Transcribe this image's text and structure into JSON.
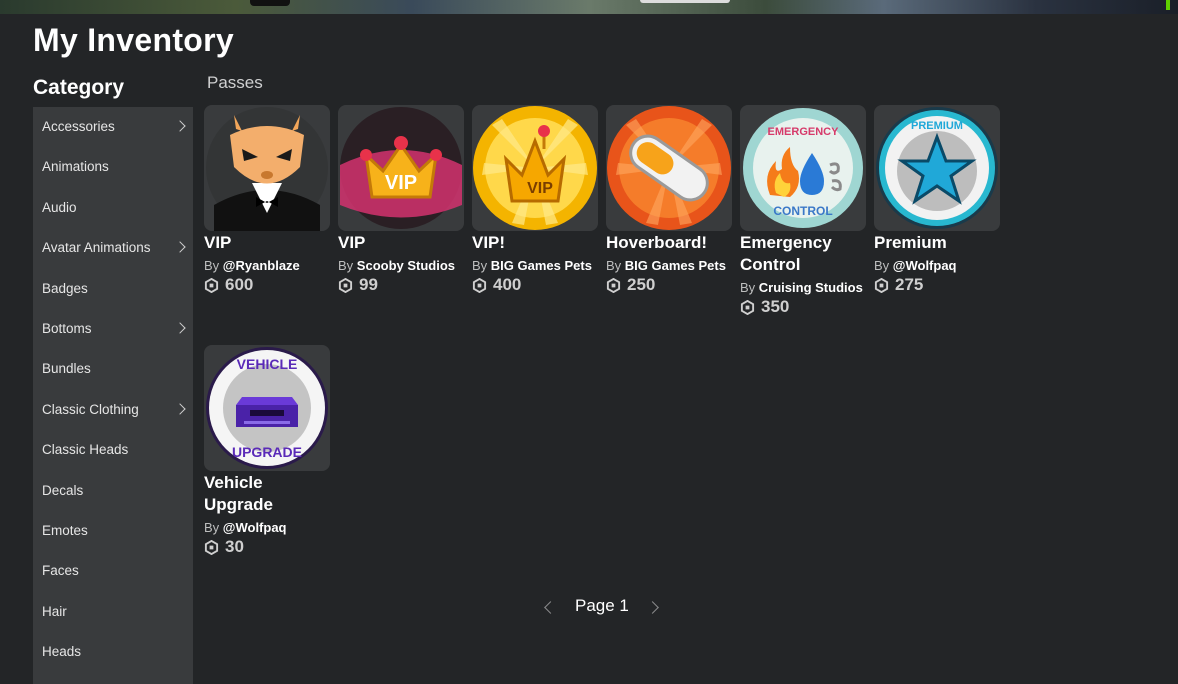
{
  "page": {
    "title": "My Inventory"
  },
  "sidebar": {
    "title": "Category",
    "items": [
      {
        "label": "Accessories",
        "has_submenu": true
      },
      {
        "label": "Animations",
        "has_submenu": false
      },
      {
        "label": "Audio",
        "has_submenu": false
      },
      {
        "label": "Avatar Animations",
        "has_submenu": true
      },
      {
        "label": "Badges",
        "has_submenu": false
      },
      {
        "label": "Bottoms",
        "has_submenu": true
      },
      {
        "label": "Bundles",
        "has_submenu": false
      },
      {
        "label": "Classic Clothing",
        "has_submenu": true
      },
      {
        "label": "Classic Heads",
        "has_submenu": false
      },
      {
        "label": "Decals",
        "has_submenu": false
      },
      {
        "label": "Emotes",
        "has_submenu": false
      },
      {
        "label": "Faces",
        "has_submenu": false
      },
      {
        "label": "Hair",
        "has_submenu": false
      },
      {
        "label": "Heads",
        "has_submenu": false
      }
    ]
  },
  "main": {
    "section_label": "Passes",
    "items": [
      {
        "name": "VIP",
        "by": "By",
        "creator": "@Ryanblaze",
        "price": "600",
        "icon": "deer-mask-icon"
      },
      {
        "name": "VIP",
        "by": "By",
        "creator": "Scooby Studios",
        "price": "99",
        "icon": "vip-crown-icon"
      },
      {
        "name": "VIP!",
        "by": "By",
        "creator": "BIG Games Pets",
        "price": "400",
        "icon": "vip-crown-gold-icon"
      },
      {
        "name": "Hoverboard!",
        "by": "By",
        "creator": "BIG Games Pets",
        "price": "250",
        "icon": "hoverboard-icon"
      },
      {
        "name": "Emergency Control",
        "by": "By",
        "creator": "Cruising Studios",
        "price": "350",
        "icon": "emergency-control-icon"
      },
      {
        "name": "Premium",
        "by": "By",
        "creator": "@Wolfpaq",
        "price": "275",
        "icon": "premium-star-icon"
      },
      {
        "name": "Vehicle Upgrade",
        "by": "By",
        "creator": "@Wolfpaq",
        "price": "30",
        "icon": "vehicle-upgrade-icon"
      }
    ],
    "badges": {
      "vip": "VIP",
      "emergency": "EMERGENCY",
      "control": "CONTROL",
      "premium": "PREMIUM",
      "vehicle": "VEHICLE",
      "upgrade": "UPGRADE"
    }
  },
  "pagination": {
    "label": "Page 1"
  },
  "colors": {
    "background": "#232527",
    "sidebar": "#393b3d",
    "card": "#393b3d"
  }
}
